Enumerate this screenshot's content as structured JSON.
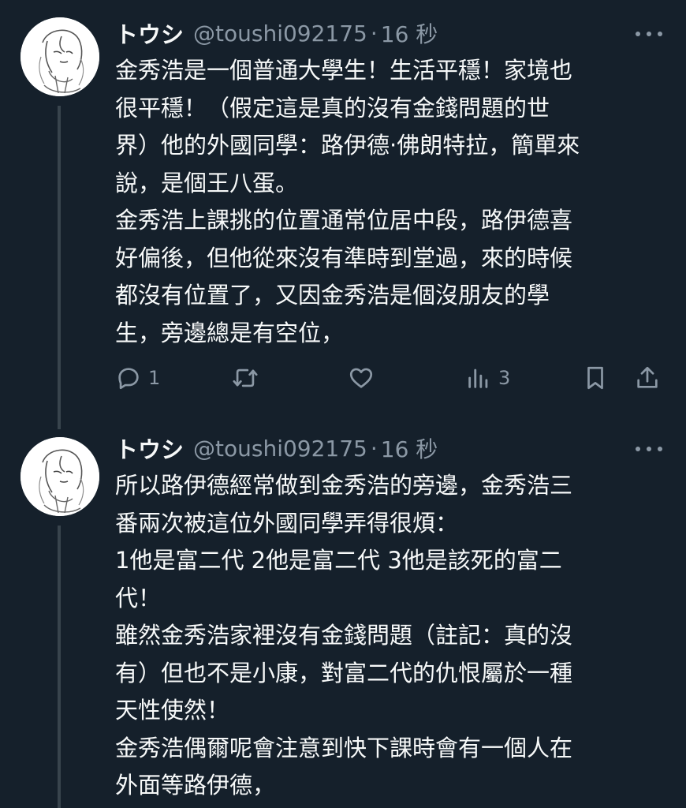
{
  "tweets": [
    {
      "display_name": "トウシ",
      "handle": "@toushi092175",
      "separator": "·",
      "time": "16 秒",
      "lines": [
        "金秀浩是一個普通大學生！生活平穩！家境也",
        "很平穩！（假定這是真的沒有金錢問題的世",
        "界）他的外國同學：路伊德·佛朗特拉，簡單來",
        "說，是個王八蛋。",
        "金秀浩上課挑的位置通常位居中段，路伊德喜",
        "好偏後，但他從來沒有準時到堂過，來的時候",
        "都沒有位置了，又因金秀浩是個沒朋友的學",
        "生，旁邊總是有空位，"
      ],
      "actions": {
        "reply_count": "1",
        "retweet_count": "",
        "like_count": "",
        "views_count": "3"
      }
    },
    {
      "display_name": "トウシ",
      "handle": "@toushi092175",
      "separator": "·",
      "time": "16 秒",
      "lines": [
        "所以路伊德經常做到金秀浩的旁邊，金秀浩三",
        "番兩次被這位外國同學弄得很煩：",
        "1他是富二代 2他是富二代 3他是該死的富二",
        "代！",
        "雖然金秀浩家裡沒有金錢問題（註記：真的沒",
        "有）但也不是小康，對富二代的仇恨屬於一種",
        "天性使然！",
        "金秀浩偶爾呢會注意到快下課時會有一個人在",
        "外面等路伊德，"
      ]
    }
  ],
  "icons": {
    "reply": "reply-icon",
    "retweet": "retweet-icon",
    "like": "heart-icon",
    "views": "views-icon",
    "bookmark": "bookmark-icon",
    "share": "share-icon",
    "more": "more-icon",
    "avatar": "avatar"
  },
  "colors": {
    "background": "#15202b",
    "text": "#f7f9f9",
    "secondary": "#8b98a5",
    "thread_line": "#38444d"
  }
}
